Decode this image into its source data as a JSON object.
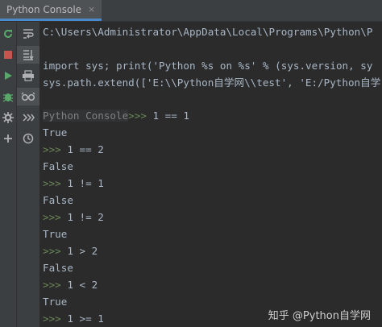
{
  "tab": {
    "title": "Python Console",
    "close_glyph": "×"
  },
  "toolbar_left": {
    "items": [
      {
        "name": "rerun-icon",
        "color": "#59a869"
      },
      {
        "name": "stop-icon",
        "color": "#c75450"
      },
      {
        "name": "run-icon",
        "color": "#59a869"
      },
      {
        "name": "debug-icon",
        "color": "#59a869"
      },
      {
        "name": "settings-icon",
        "color": "#afb1b3"
      },
      {
        "name": "add-icon",
        "color": "#afb1b3"
      }
    ]
  },
  "toolbar_right": {
    "items": [
      {
        "name": "soft-wrap-icon"
      },
      {
        "name": "scroll-to-end-icon"
      },
      {
        "name": "print-icon"
      },
      {
        "name": "show-variables-icon"
      },
      {
        "name": "execute-all-icon"
      },
      {
        "name": "history-icon"
      }
    ]
  },
  "console": {
    "header_lines": [
      "C:\\Users\\Administrator\\AppData\\Local\\Programs\\Python\\P",
      "",
      "import sys; print('Python %s on %s' % (sys.version, sy",
      "sys.path.extend(['E:\\\\Python自学网\\\\test', 'E:/Python自学"
    ],
    "console_tag": "Python Console",
    "prompt": ">>> ",
    "first_input": "1 == 1",
    "entries": [
      {
        "output": "True",
        "input": "1 == 2"
      },
      {
        "output": "False",
        "input": "1 != 1"
      },
      {
        "output": "False",
        "input": "1 != 2"
      },
      {
        "output": "True",
        "input": "1 > 2"
      },
      {
        "output": "False",
        "input": "1 < 2"
      },
      {
        "output": "True",
        "input": "1 >= 1"
      }
    ]
  },
  "watermark": {
    "text": "知乎 @Python自学网"
  },
  "colors": {
    "background": "#2b2b2b",
    "prompt": "#6a8759",
    "text": "#a9b7c6",
    "tab_accent": "#4a88c7"
  }
}
